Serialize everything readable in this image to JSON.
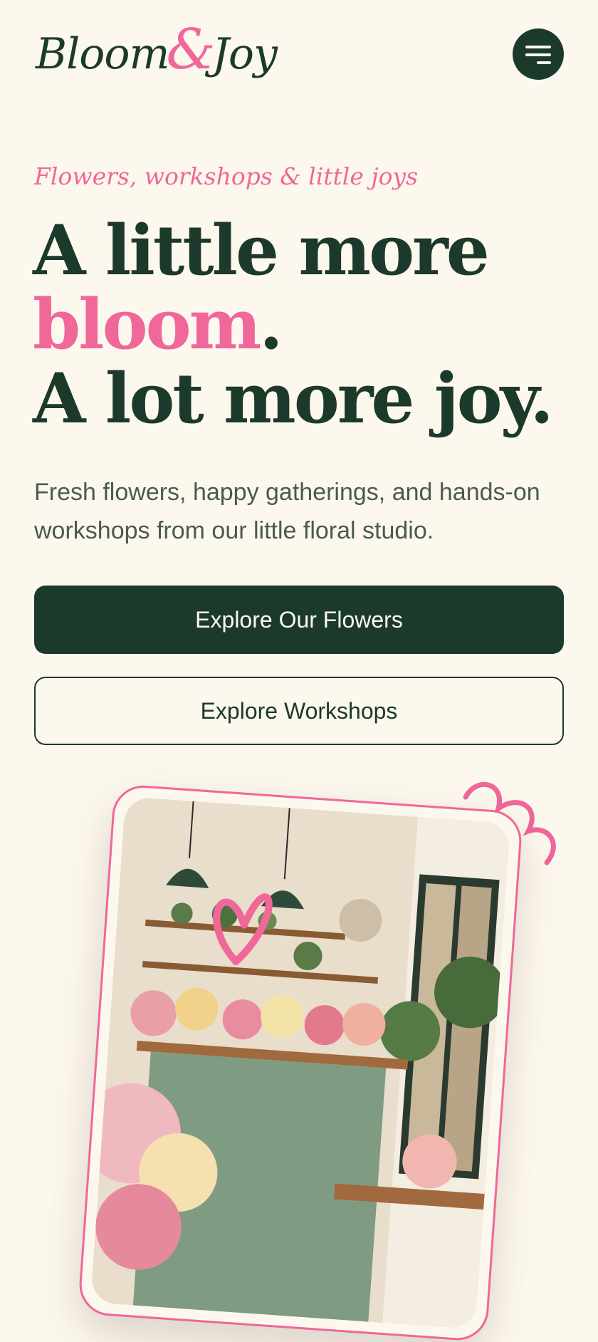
{
  "brand": {
    "name_part1": "Bloom",
    "ampersand": "&",
    "name_part2": "Joy"
  },
  "nav": {
    "menu_icon": "menu-icon"
  },
  "hero": {
    "tagline": "Flowers, workshops & little joys",
    "headline": {
      "line1": "A little more",
      "line2_accent": "bloom",
      "line2_end": ".",
      "line3": "A lot more joy."
    },
    "description": "Fresh flowers, happy gatherings, and hands-on workshops from our little floral studio.",
    "primary_cta": "Explore Our Flowers",
    "secondary_cta": "Explore Workshops"
  },
  "decor": {
    "squiggle_icon": "squiggle-icon",
    "heart_icon": "heart-doodle-icon"
  },
  "colors": {
    "background": "#fdf8ee",
    "primary": "#1b3a2b",
    "accent": "#f0679a",
    "text_muted": "#4b5a4e"
  }
}
